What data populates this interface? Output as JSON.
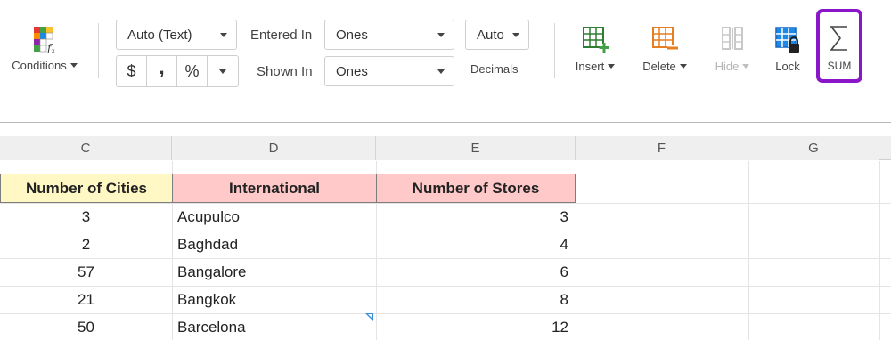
{
  "toolbar": {
    "conditions_label": "Conditions",
    "number_format": "Auto (Text)",
    "currency_symbol": "$",
    "comma_symbol": ",",
    "percent_symbol": "%",
    "entered_in_label": "Entered In",
    "entered_in_value": "Ones",
    "shown_in_label": "Shown In",
    "shown_in_value": "Ones",
    "decimals_value": "Auto",
    "decimals_label": "Decimals",
    "insert_label": "Insert",
    "delete_label": "Delete",
    "hide_label": "Hide",
    "lock_label": "Lock",
    "sum_label": "SUM",
    "highlight_color": "#8a16c9"
  },
  "grid": {
    "columns": [
      "C",
      "D",
      "E",
      "F",
      "G"
    ],
    "headers": {
      "c": "Number of Cities",
      "d": "International",
      "e": "Number of Stores",
      "c_color": "#fff8c4",
      "d_color": "#ffc9c9",
      "e_color": "#ffc9c9"
    },
    "rows": [
      {
        "cities": "3",
        "international": "Acupulco",
        "stores": "3"
      },
      {
        "cities": "2",
        "international": "Baghdad",
        "stores": "4"
      },
      {
        "cities": "57",
        "international": "Bangalore",
        "stores": "6"
      },
      {
        "cities": "21",
        "international": "Bangkok",
        "stores": "8"
      },
      {
        "cities": "50",
        "international": "Barcelona",
        "stores": "12"
      }
    ]
  }
}
